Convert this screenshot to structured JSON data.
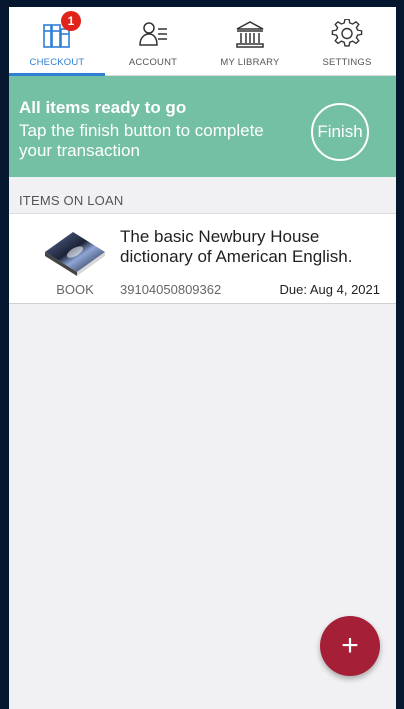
{
  "colors": {
    "accent": "#2f7fd4",
    "banner": "#73c0a4",
    "badge": "#e0241b",
    "fab": "#a51f37"
  },
  "tabs": [
    {
      "label": "CHECKOUT",
      "icon": "books-icon",
      "active": true,
      "badge": "1"
    },
    {
      "label": "ACCOUNT",
      "icon": "account-icon",
      "active": false
    },
    {
      "label": "MY LIBRARY",
      "icon": "library-icon",
      "active": false
    },
    {
      "label": "SETTINGS",
      "icon": "gear-icon",
      "active": false
    }
  ],
  "banner": {
    "title": "All items ready to go",
    "subtitle": "Tap the finish button to complete your transaction",
    "finish_label": "Finish"
  },
  "loan_section": {
    "header": "ITEMS ON LOAN",
    "items": [
      {
        "title": "The basic Newbury House dictionary of American English.",
        "type": "BOOK",
        "barcode": "39104050809362",
        "due": "Due: Aug 4, 2021",
        "thumb_icon": "book-cover-icon"
      }
    ]
  },
  "fab": {
    "label": "+",
    "icon": "add-icon"
  }
}
